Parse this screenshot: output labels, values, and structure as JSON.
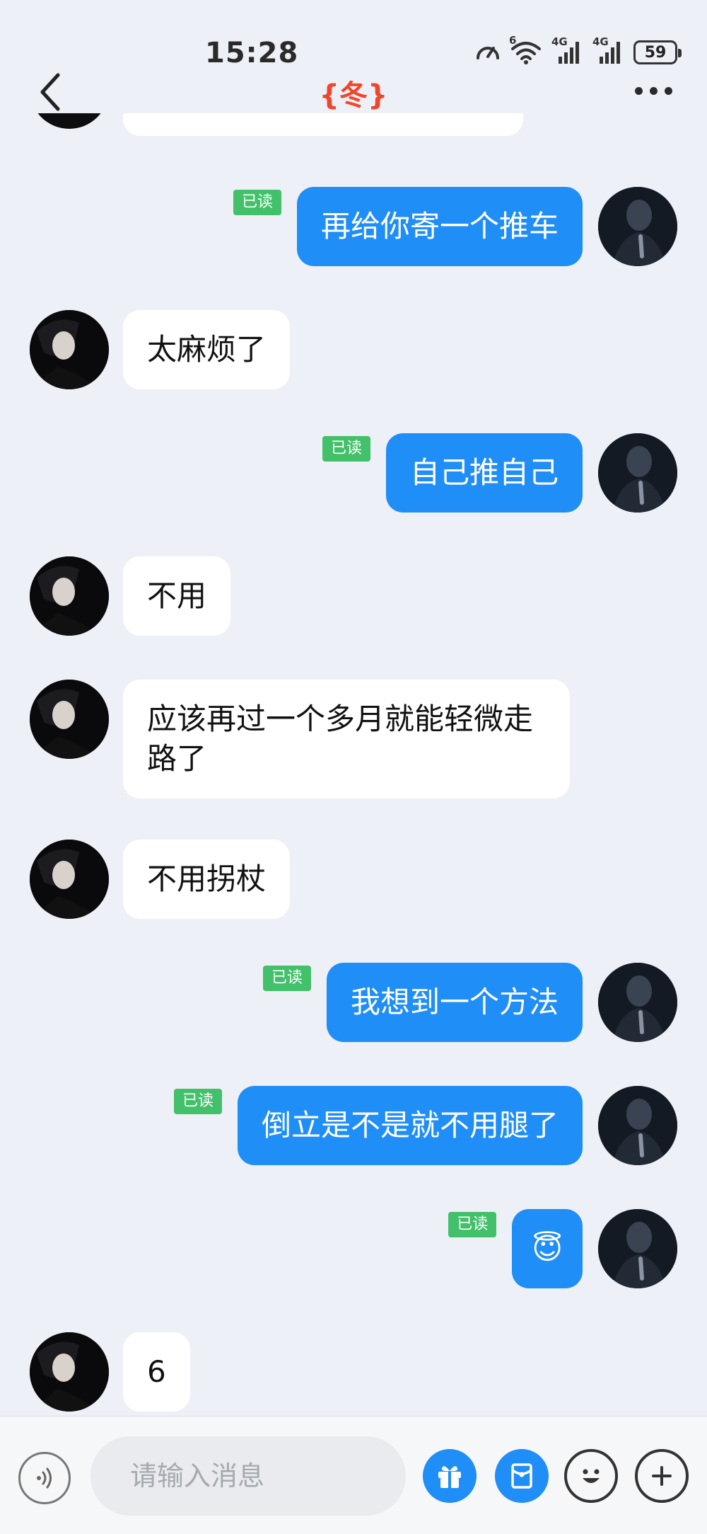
{
  "status_bar": {
    "time": "15:28",
    "battery": "59",
    "network_1": "4G",
    "network_2": "4G",
    "wifi_badge": "6"
  },
  "nav": {
    "title": "{冬}"
  },
  "messages": [
    {
      "side": "out",
      "text": "再给你寄一个推车",
      "read": "已读"
    },
    {
      "side": "in",
      "text": "太麻烦了"
    },
    {
      "side": "out",
      "text": "自己推自己",
      "read": "已读"
    },
    {
      "side": "in",
      "text": "不用"
    },
    {
      "side": "in",
      "text": "应该再过一个多月就能轻微走路了"
    },
    {
      "side": "in",
      "text": "不用拐杖"
    },
    {
      "side": "out",
      "text": "我想到一个方法",
      "read": "已读"
    },
    {
      "side": "out",
      "text": "倒立是不是就不用腿了",
      "read": "已读"
    },
    {
      "side": "out",
      "text": "😇",
      "read": "已读"
    },
    {
      "side": "in",
      "text": "6"
    }
  ],
  "input_bar": {
    "placeholder": "请输入消息"
  },
  "colors": {
    "outgoing_bubble": "#1f8ef6",
    "incoming_bubble": "#ffffff",
    "read_badge": "#43c06a",
    "title": "#f0462c",
    "background": "#edf0f6"
  }
}
